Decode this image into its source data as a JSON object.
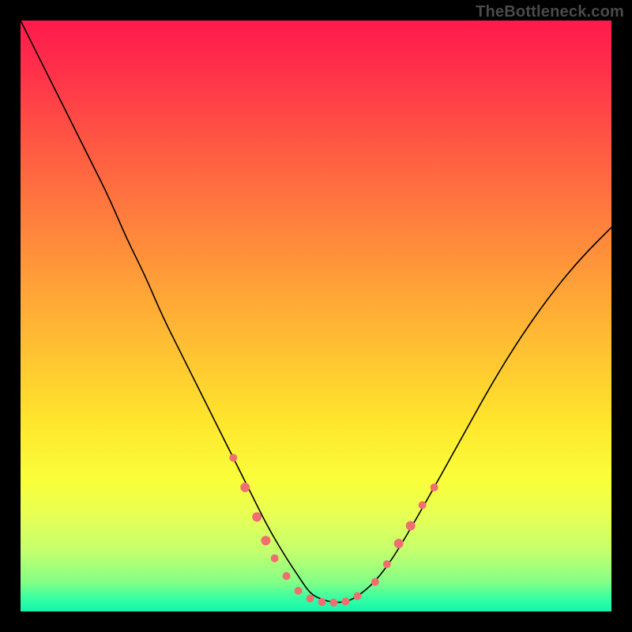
{
  "attribution": "TheBottleneck.com",
  "chart_data": {
    "type": "line",
    "title": "",
    "xlabel": "",
    "ylabel": "",
    "xlim": [
      0,
      100
    ],
    "ylim": [
      0,
      100
    ],
    "grid": false,
    "legend": false,
    "series": [
      {
        "name": "bottleneck-curve",
        "x": [
          0,
          3,
          6,
          9,
          12,
          15,
          18,
          21,
          24,
          27,
          30,
          33,
          36,
          39,
          42,
          45,
          47,
          49,
          51,
          53,
          55,
          57,
          60,
          63,
          66,
          70,
          75,
          80,
          85,
          90,
          95,
          100
        ],
        "y": [
          100,
          94,
          88,
          82,
          76,
          70,
          63,
          57,
          50,
          44,
          38,
          32,
          26,
          20,
          14,
          9,
          6,
          3,
          2,
          1.5,
          1.6,
          2.5,
          5,
          9,
          14,
          21,
          30,
          39,
          47,
          54,
          60,
          65
        ],
        "stroke": "#000000",
        "stroke_width": 1.6
      }
    ],
    "markers": {
      "name": "highlighted-points",
      "color": "#ef6f6f",
      "points": [
        {
          "x": 36,
          "y": 26,
          "r": 5
        },
        {
          "x": 38,
          "y": 21,
          "r": 6
        },
        {
          "x": 40,
          "y": 16,
          "r": 6
        },
        {
          "x": 41.5,
          "y": 12,
          "r": 6
        },
        {
          "x": 43,
          "y": 9,
          "r": 5
        },
        {
          "x": 45,
          "y": 6,
          "r": 5
        },
        {
          "x": 47,
          "y": 3.5,
          "r": 5
        },
        {
          "x": 49,
          "y": 2.2,
          "r": 5
        },
        {
          "x": 51,
          "y": 1.6,
          "r": 5
        },
        {
          "x": 53,
          "y": 1.5,
          "r": 5
        },
        {
          "x": 55,
          "y": 1.7,
          "r": 5
        },
        {
          "x": 57,
          "y": 2.6,
          "r": 5
        },
        {
          "x": 60,
          "y": 5,
          "r": 5
        },
        {
          "x": 62,
          "y": 8,
          "r": 5
        },
        {
          "x": 64,
          "y": 11.5,
          "r": 6
        },
        {
          "x": 66,
          "y": 14.5,
          "r": 6
        },
        {
          "x": 68,
          "y": 18,
          "r": 5
        },
        {
          "x": 70,
          "y": 21,
          "r": 5
        }
      ]
    }
  }
}
